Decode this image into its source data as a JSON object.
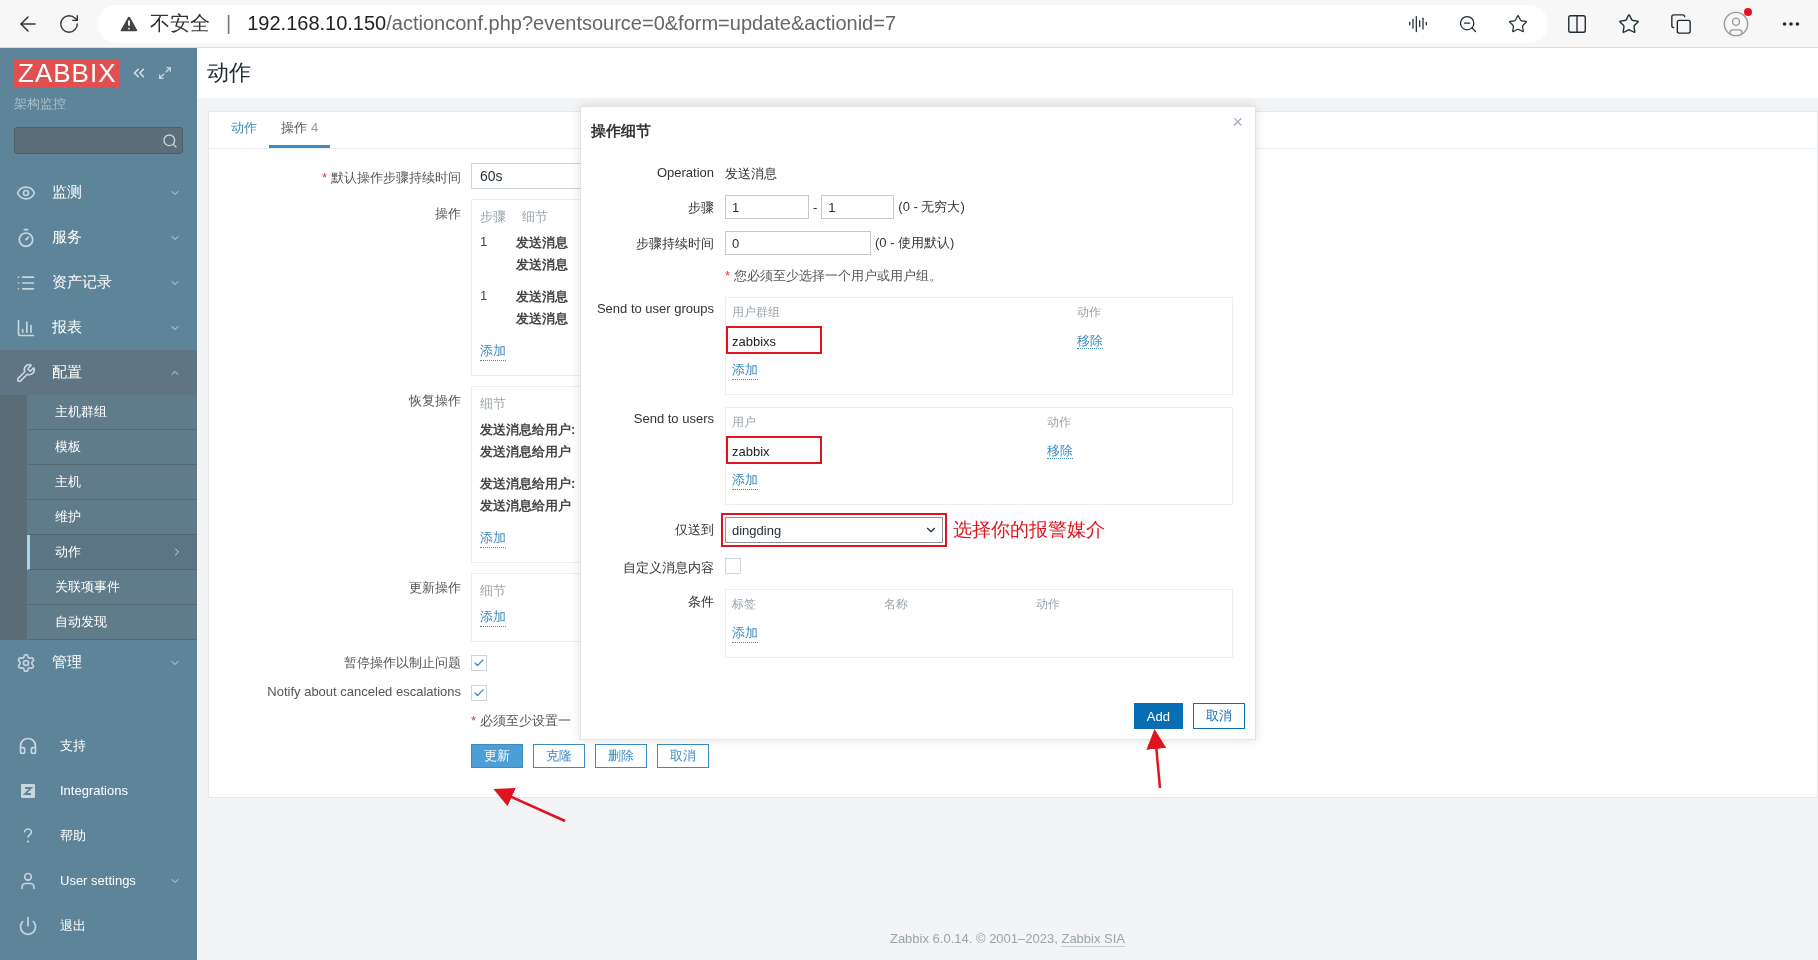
{
  "browser": {
    "security": "不安全",
    "separator": "|",
    "url_host": "192.168.10.150",
    "url_path": "/actionconf.php?eventsource=0&form=update&actionid=7"
  },
  "sidebar": {
    "logo": "ZABBIX",
    "subtitle": "架构监控",
    "menu": [
      {
        "label": "监测",
        "expanded": false
      },
      {
        "label": "服务",
        "expanded": false
      },
      {
        "label": "资产记录",
        "expanded": false
      },
      {
        "label": "报表",
        "expanded": false
      },
      {
        "label": "配置",
        "expanded": true,
        "children": [
          {
            "label": "主机群组",
            "selected": false
          },
          {
            "label": "模板",
            "selected": false
          },
          {
            "label": "主机",
            "selected": false
          },
          {
            "label": "维护",
            "selected": false
          },
          {
            "label": "动作",
            "selected": true
          },
          {
            "label": "关联项事件",
            "selected": false
          },
          {
            "label": "自动发现",
            "selected": false
          }
        ]
      },
      {
        "label": "管理",
        "expanded": false
      }
    ],
    "bottom": [
      {
        "label": "支持"
      },
      {
        "label": "Integrations"
      },
      {
        "label": "帮助"
      },
      {
        "label": "User settings",
        "expanded": false
      },
      {
        "label": "退出"
      }
    ]
  },
  "page": {
    "title": "动作"
  },
  "tabs": [
    {
      "label": "动作",
      "selected": false
    },
    {
      "label": "操作",
      "count": "4",
      "selected": true
    }
  ],
  "form": {
    "duration": {
      "mark": "*",
      "label": "默认操作步骤持续时间",
      "value": "60s"
    },
    "operations": {
      "label": "操作",
      "columns": [
        "步骤",
        "细节"
      ],
      "rows": [
        {
          "step": "1",
          "lines": [
            "发送消息",
            "发送消息"
          ]
        },
        {
          "step": "1",
          "lines": [
            "发送消息",
            "发送消息"
          ]
        }
      ],
      "add": "添加"
    },
    "recovery": {
      "label": "恢复操作",
      "columns": [
        "细节"
      ],
      "rows": [
        {
          "lines": [
            "发送消息给用户:",
            "发送消息给用户"
          ]
        },
        {
          "lines": [
            "发送消息给用户:",
            "发送消息给用户"
          ]
        }
      ],
      "add": "添加"
    },
    "update": {
      "label": "更新操作",
      "columns": [
        "细节"
      ],
      "add": "添加"
    },
    "checks": [
      {
        "label": "暂停操作以制止问题",
        "checked": true
      },
      {
        "label": "Notify about canceled escalations",
        "checked": true
      }
    ],
    "note": {
      "mark": "*",
      "text": "必须至少设置一"
    },
    "buttons": [
      {
        "label": "更新",
        "kind": "primary"
      },
      {
        "label": "克隆",
        "kind": "secondary"
      },
      {
        "label": "删除",
        "kind": "secondary"
      },
      {
        "label": "取消",
        "kind": "secondary"
      }
    ]
  },
  "dialog": {
    "title": "操作细节",
    "close": "×",
    "operation": {
      "label": "Operation",
      "value": "发送消息"
    },
    "steps": {
      "label": "步骤",
      "from": "1",
      "dash": "-",
      "to": "1",
      "hint": "(0 - 无穷大)"
    },
    "step_duration": {
      "label": "步骤持续时间",
      "value": "0",
      "hint": "(0 - 使用默认)"
    },
    "note": {
      "mark": "*",
      "text": "您必须至少选择一个用户或用户组。"
    },
    "user_groups": {
      "label": "Send to user groups",
      "columns": [
        "用户群组",
        "动作"
      ],
      "rows": [
        {
          "name": "zabbixs",
          "action": "移除",
          "highlighted": true
        }
      ],
      "add": "添加"
    },
    "users": {
      "label": "Send to users",
      "columns": [
        "用户",
        "动作"
      ],
      "rows": [
        {
          "name": "zabbix",
          "action": "移除",
          "highlighted": true
        }
      ],
      "add": "添加"
    },
    "send_only_to": {
      "label": "仅送到",
      "value": "dingding",
      "highlighted": true
    },
    "custom_message": {
      "label": "自定义消息内容",
      "checked": false
    },
    "conditions": {
      "label": "条件",
      "columns": [
        "标签",
        "名称",
        "动作"
      ],
      "add": "添加"
    },
    "buttons": [
      {
        "label": "Add",
        "kind": "primary"
      },
      {
        "label": "取消",
        "kind": "secondary"
      }
    ]
  },
  "annotation": {
    "text": "选择你的报警媒介"
  },
  "footer": {
    "text": "Zabbix 6.0.14. © 2001–2023, ",
    "link": "Zabbix SIA"
  }
}
